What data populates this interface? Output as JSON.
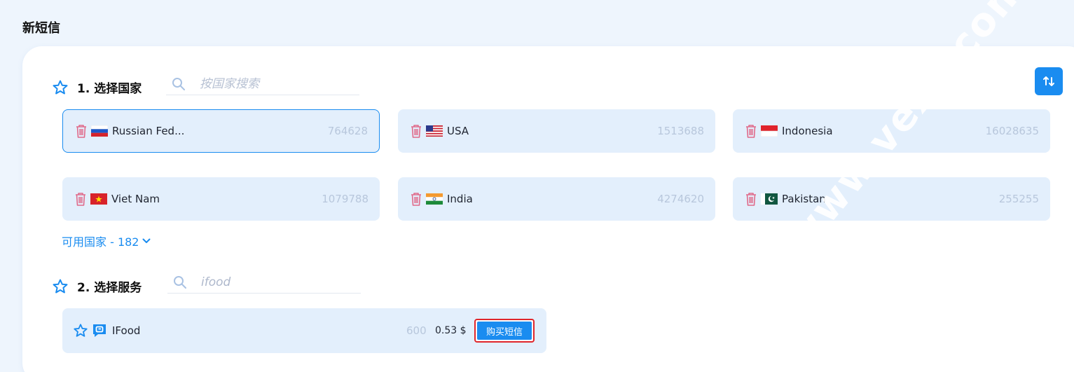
{
  "page": {
    "title": "新短信"
  },
  "section_country": {
    "title": "1. 选择国家",
    "search_placeholder": "按国家搜索",
    "countries": [
      {
        "name": "Russian Fed...",
        "count": "764628",
        "flag": "russia-flag",
        "selected": true
      },
      {
        "name": "USA",
        "count": "1513688",
        "flag": "usa-flag"
      },
      {
        "name": "Indonesia",
        "count": "16028635",
        "flag": "indonesia-flag"
      },
      {
        "name": "Viet Nam",
        "count": "1079788",
        "flag": "vietnam-flag"
      },
      {
        "name": "India",
        "count": "4274620",
        "flag": "india-flag"
      },
      {
        "name": "Pakistan",
        "count": "255255",
        "flag": "pakistan-flag"
      }
    ],
    "available_label": "可用国家 - 182"
  },
  "section_service": {
    "title": "2. 选择服务",
    "search_value": "ifood",
    "services": [
      {
        "name": "IFood",
        "count": "600",
        "price": "0.53 $",
        "buy_label": "购买短信"
      }
    ]
  },
  "watermark": "www.vexk.com",
  "colors": {
    "accent": "#1a8cf0",
    "card_bg": "#e3effc",
    "highlight_border": "#e0262b"
  }
}
